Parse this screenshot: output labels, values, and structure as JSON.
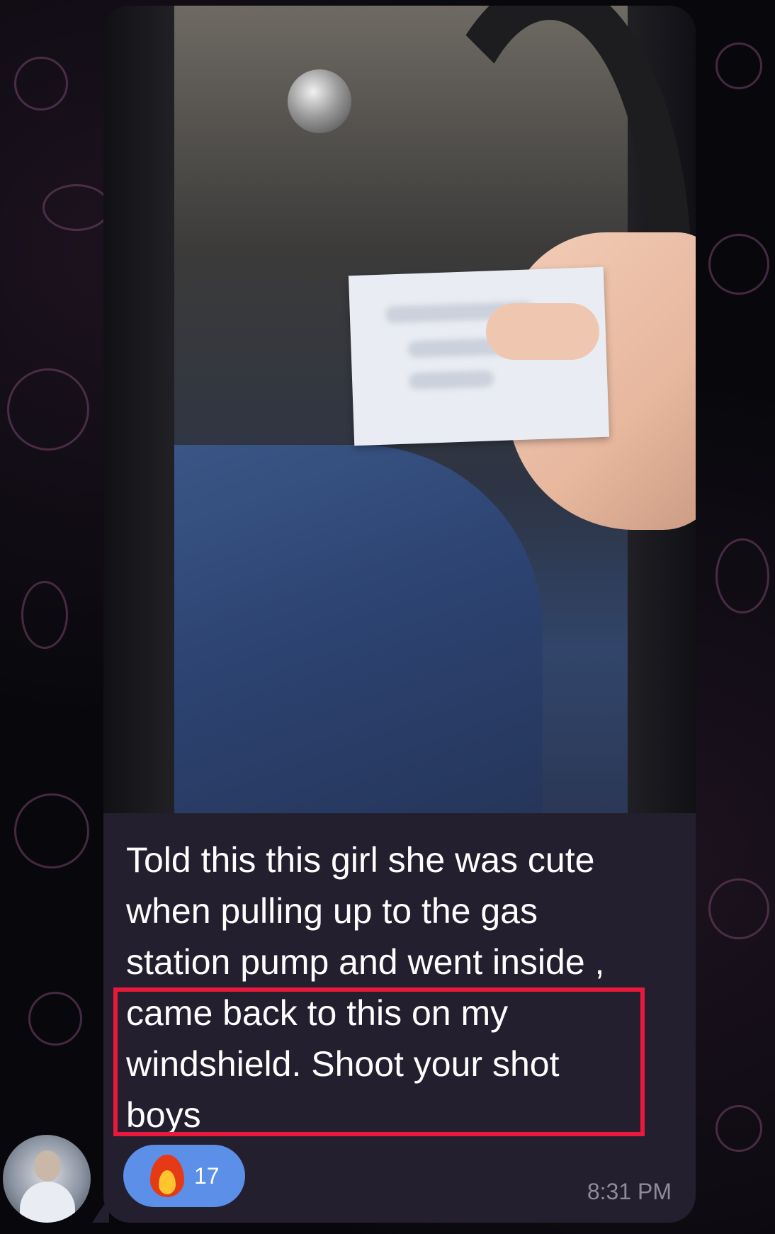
{
  "message": {
    "text_lines": [
      "Told this this girl she was cute",
      "when pulling up to the gas",
      "station pump and went inside ,",
      "came back to this on my",
      "windshield.  Shoot your shot",
      "boys"
    ],
    "media_description": "",
    "timestamp": "8:31 PM",
    "reaction": {
      "icon": "fire-icon",
      "count": "17"
    },
    "highlight_color": "#e8193a",
    "bubble_color": "#231f2e",
    "reaction_color": "#5b8fe8"
  }
}
